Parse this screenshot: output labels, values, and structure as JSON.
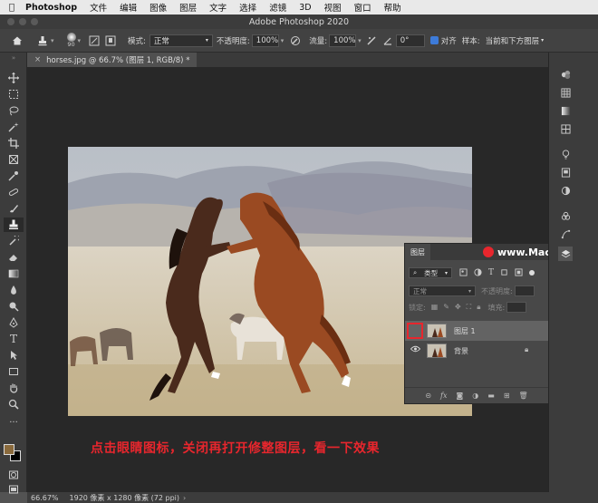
{
  "menubar": {
    "app_name": "Photoshop",
    "items": [
      "文件",
      "编辑",
      "图像",
      "图层",
      "文字",
      "选择",
      "滤镜",
      "3D",
      "视图",
      "窗口",
      "帮助"
    ]
  },
  "window": {
    "title": "Adobe Photoshop 2020"
  },
  "options": {
    "brush_size": "90",
    "mode_label": "模式:",
    "mode_value": "正常",
    "opacity_label": "不透明度:",
    "opacity_value": "100%",
    "flow_label": "流量:",
    "flow_value": "100%",
    "angle_value": "0°",
    "align_label": "对齐",
    "sample_label": "样本:",
    "sample_value": "当前和下方图层"
  },
  "document": {
    "tab_label": "horses.jpg @ 66.7% (图层 1, RGB/8) *"
  },
  "layers_panel": {
    "tab_label": "图层",
    "kind_filter": "类型",
    "blend_mode": "正常",
    "opacity_label": "不透明度:",
    "lock_label": "锁定:",
    "fill_label": "填充:",
    "layers": [
      {
        "name": "图层 1",
        "visible": false,
        "selected": true
      },
      {
        "name": "背景",
        "visible": true,
        "selected": false,
        "locked": true
      }
    ]
  },
  "watermark": "www.MacZ.com",
  "caption": "点击眼睛图标，关闭再打开修整图层，看一下效果",
  "status": {
    "zoom": "66.67%",
    "info": "1920 像素 x 1280 像素 (72 ppi)"
  },
  "colors": {
    "highlight": "#e8262d",
    "accent": "#3d7bd9",
    "foreground": "#8a6a3c",
    "background": "#000000"
  }
}
